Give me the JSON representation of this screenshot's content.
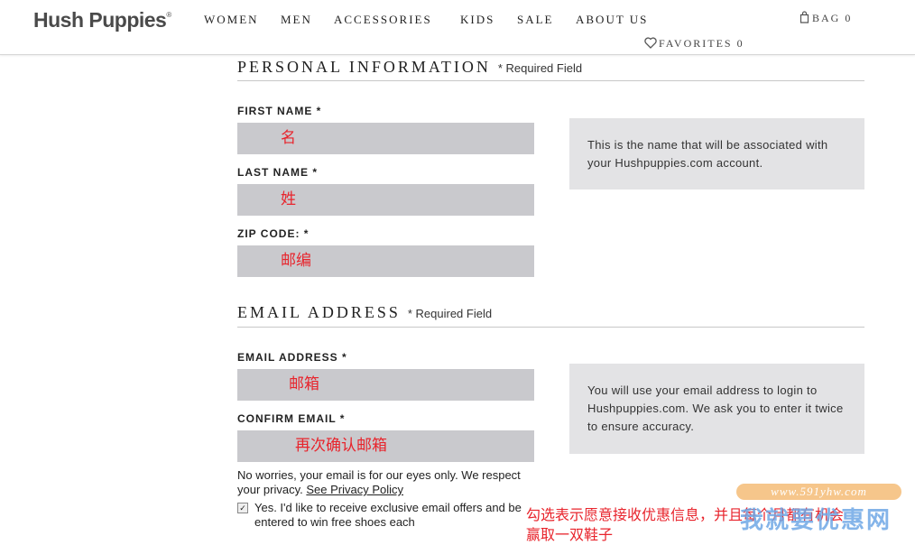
{
  "header": {
    "logo": "Hush Puppies",
    "logo_mark": "®",
    "nav": [
      "WOMEN",
      "MEN",
      "ACCESSORIES",
      "KIDS",
      "SALE",
      "ABOUT US"
    ],
    "bag_label": "BAG",
    "bag_count": "0",
    "favorites_label": "FAVORITES",
    "favorites_count": "0"
  },
  "personal": {
    "title": "PERSONAL INFORMATION",
    "required_note": "* Required Field",
    "first_name_label": "FIRST NAME *",
    "first_name_value": "名",
    "last_name_label": "LAST NAME *",
    "last_name_value": "姓",
    "zip_label": "ZIP CODE: *",
    "zip_value": "邮编",
    "info": "This is the name that will be associated with your Hushpuppies.com account."
  },
  "email": {
    "title": "EMAIL ADDRESS",
    "required_note": "* Required Field",
    "email_label": "EMAIL ADDRESS *",
    "email_value": "邮箱",
    "confirm_label": "CONFIRM EMAIL *",
    "confirm_value": "再次确认邮箱",
    "info": "You will use your email address to login to Hushpuppies.com. We ask you to enter it twice to ensure accuracy.",
    "privacy_text": "No worries, your email is for our eyes only. We respect your privacy.",
    "privacy_link": "See Privacy Policy",
    "optin_checked": true,
    "optin_text": "Yes. I'd like to receive exclusive email offers and be entered to win free shoes each"
  },
  "annotation": {
    "line1": "勾选表示愿意接收优惠信息，并且每个月都有机会",
    "line2": "赢取一双鞋子"
  },
  "watermark": {
    "url": "www.591yhw.com",
    "text": "我就要优惠网"
  },
  "colors": {
    "input_bg": "#c9c9cd",
    "info_bg": "#e3e3e5",
    "annotation_red": "#e8242c"
  }
}
